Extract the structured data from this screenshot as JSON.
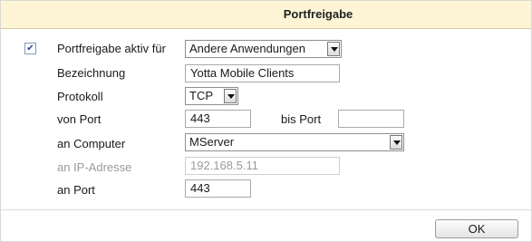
{
  "dialog": {
    "title": "Portfreigabe"
  },
  "form": {
    "enable_checkbox_checked": true,
    "enable_label": "Portfreigabe aktiv für",
    "application_select": "Andere Anwendungen",
    "name_label": "Bezeichnung",
    "name_value": "Yotta Mobile Clients",
    "protocol_label": "Protokoll",
    "protocol_select": "TCP",
    "from_port_label": "von Port",
    "from_port_value": "443",
    "to_port_label": "bis Port",
    "to_port_value": "",
    "computer_label": "an Computer",
    "computer_select": "MServer",
    "ip_label": "an IP-Adresse",
    "ip_value": "192.168.5.11",
    "target_port_label": "an Port",
    "target_port_value": "443"
  },
  "footer": {
    "ok_label": "OK"
  },
  "icons": {
    "checkbox": "checkmark-icon",
    "dropdown": "chevron-down-icon"
  }
}
